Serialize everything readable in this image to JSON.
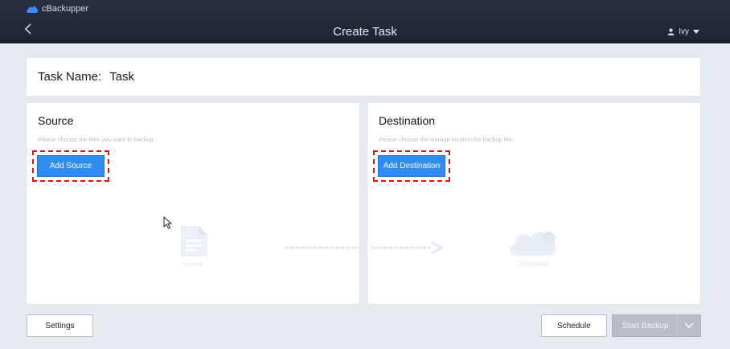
{
  "app": {
    "brand": "cBackupper",
    "title": "Create Task",
    "user": "Ivy"
  },
  "task": {
    "label": "Task Name:",
    "value": "Task"
  },
  "source": {
    "heading": "Source",
    "hint": "Please choose the files you want to backup.",
    "add_label": "Add Source",
    "ghost_label": "Source"
  },
  "destination": {
    "heading": "Destination",
    "hint": "Please choose the storage location for backup file.",
    "add_label": "Add Destination",
    "ghost_label": "Destination"
  },
  "footer": {
    "settings_label": "Settings",
    "schedule_label": "Schedule",
    "start_label": "Start Backup"
  },
  "colors": {
    "header_bg": "#1f2835",
    "accent": "#2f8cf5",
    "highlight_dash": "#d4141a",
    "disabled_btn": "#b9bec6"
  },
  "icons": [
    "cloud-logo-icon",
    "back-arrow-icon",
    "user-icon",
    "caret-down-icon",
    "document-icon",
    "flow-arrow-icon",
    "cloud-icon",
    "mouse-cursor-icon",
    "chevron-down-icon"
  ]
}
